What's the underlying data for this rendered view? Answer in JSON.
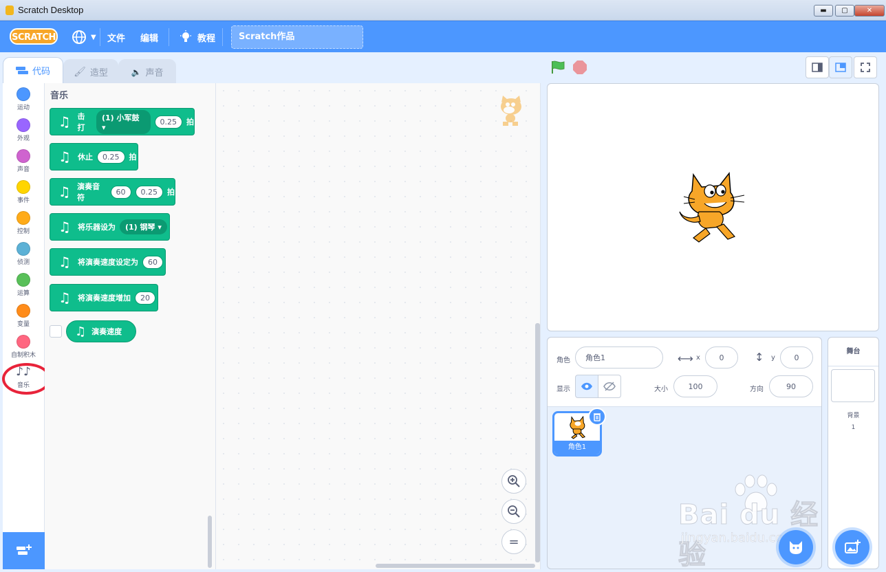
{
  "window": {
    "title": "Scratch Desktop",
    "min": "▬",
    "max": "▢",
    "close": "✕"
  },
  "menubar": {
    "logo": "SCRATCH",
    "language_icon": "globe-icon",
    "file": "文件",
    "edit": "编辑",
    "tutorials": "教程",
    "project_title": "Scratch作品"
  },
  "tabs": [
    {
      "label": "代码",
      "icon": "code-icon",
      "active": true
    },
    {
      "label": "造型",
      "icon": "brush-icon",
      "active": false
    },
    {
      "label": "声音",
      "icon": "speaker-icon",
      "active": false
    }
  ],
  "categories": [
    {
      "label": "运动",
      "color": "#4c97ff"
    },
    {
      "label": "外观",
      "color": "#9966ff"
    },
    {
      "label": "声音",
      "color": "#cf63cf"
    },
    {
      "label": "事件",
      "color": "#ffbf00"
    },
    {
      "label": "控制",
      "color": "#ffab19"
    },
    {
      "label": "侦测",
      "color": "#5cb1d6"
    },
    {
      "label": "运算",
      "color": "#59c059"
    },
    {
      "label": "变量",
      "color": "#ff8c1a"
    },
    {
      "label": "自制积木",
      "color": "#ff6680"
    },
    {
      "label": "音乐",
      "color": "#0fbd8c"
    }
  ],
  "palette": {
    "title": "音乐",
    "blocks": [
      {
        "parts": [
          "击打",
          "(1) 小军鼓 ▾",
          "0.25",
          "拍"
        ]
      },
      {
        "parts": [
          "休止",
          "0.25",
          "拍"
        ]
      },
      {
        "parts": [
          "演奏音符",
          "60",
          "0.25",
          "拍"
        ]
      },
      {
        "parts": [
          "将乐器设为",
          "(1) 钢琴 ▾"
        ]
      },
      {
        "parts": [
          "将演奏速度设定为",
          "60"
        ]
      },
      {
        "parts": [
          "将演奏速度增加",
          "20"
        ]
      }
    ],
    "reporter": "演奏速度"
  },
  "zoom": {
    "in": "+",
    "out": "−",
    "reset": "="
  },
  "sprite_info": {
    "sprite_label": "角色",
    "sprite_name": "角色1",
    "x_label": "x",
    "x_value": "0",
    "y_label": "y",
    "y_value": "0",
    "show_label": "显示",
    "size_label": "大小",
    "size_value": "100",
    "direction_label": "方向",
    "direction_value": "90"
  },
  "sprites": [
    {
      "name": "角色1",
      "selected": true
    }
  ],
  "stage_pane": {
    "title": "舞台",
    "backdrops_label": "背景",
    "backdrops_count": "1"
  },
  "watermark": {
    "main": "Bai du 经验",
    "sub": "jingyan.baidu.com"
  },
  "colors": {
    "accent": "#4c97ff",
    "music": "#0fbd8c",
    "highlight": "#e8233a"
  }
}
